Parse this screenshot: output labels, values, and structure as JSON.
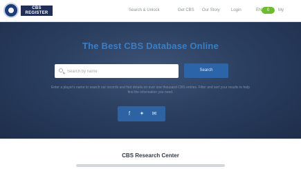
{
  "header": {
    "logo_text": "CBS\nREGISTER",
    "nav": [
      "Search & Unlock",
      "Get CBS",
      "Our Story",
      "Login"
    ],
    "lang": "EN",
    "cart_badge": "0",
    "account": "My"
  },
  "hero": {
    "title": "The Best CBS Database Online",
    "search_placeholder": "Search by name",
    "search_button": "Search",
    "note": "Enter a player's name to search our records and find details on over one thousand CBS entries. Filter and sort your results to help find the information you need.",
    "social_icons": [
      "facebook-icon",
      "twitter-icon",
      "email-icon"
    ]
  },
  "section": {
    "title": "CBS Research Center"
  },
  "colors": {
    "accent": "#2b64a8",
    "hero_title": "#3a7ec4",
    "cart_badge": "#6dbb2f"
  }
}
